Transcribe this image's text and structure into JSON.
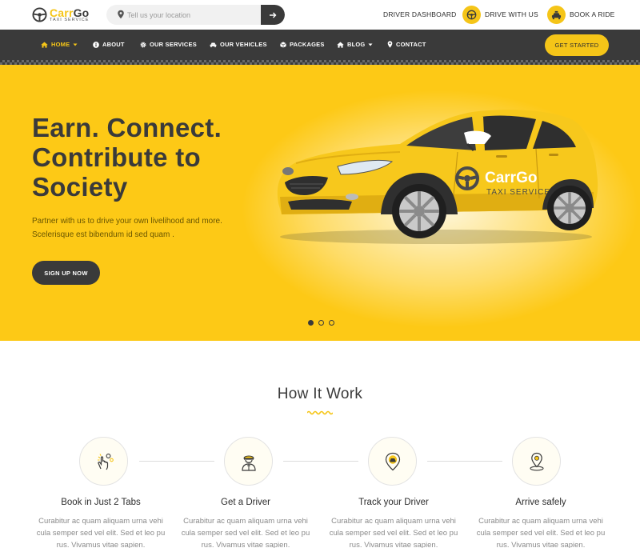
{
  "brand": {
    "name_part1": "Carr",
    "name_part2": "Go",
    "tagline": "TAXI SERVICE",
    "color_primary": "#f5c518",
    "color_dark": "#3a3a3a"
  },
  "search": {
    "placeholder": "Tell us your location",
    "icon": "map-pin-icon",
    "submit_icon": "arrow-right-icon"
  },
  "top_links": {
    "driver_dashboard": "DRIVER DASHBOARD",
    "drive_with_us": "DRIVE WITH US",
    "book_a_ride": "BOOK A RIDE"
  },
  "nav": {
    "items": [
      {
        "label": "HOME",
        "icon": "home-icon",
        "dropdown": true,
        "active": true
      },
      {
        "label": "ABOUT",
        "icon": "info-icon"
      },
      {
        "label": "OUR SERVICES",
        "icon": "gear-icon"
      },
      {
        "label": "OUR VEHICLES",
        "icon": "car-icon"
      },
      {
        "label": "PACKAGES",
        "icon": "box-icon"
      },
      {
        "label": "BLOG",
        "icon": "home-icon",
        "dropdown": true
      },
      {
        "label": "CONTACT",
        "icon": "map-pin-icon"
      }
    ],
    "cta": "GET STARTED"
  },
  "hero": {
    "title_lines": [
      "Earn. Connect.",
      "Contribute to",
      "Society"
    ],
    "text_lines": [
      "Partner with us to drive your own livelihood and more.",
      "Scelerisque est bibendum id sed quam ."
    ],
    "button": "SIGN UP NOW",
    "car_brand_1": "Carr",
    "car_brand_2": "Go",
    "car_tagline": "TAXI SERVICE",
    "slides_total": 3,
    "slide_active": 1
  },
  "how_it_works": {
    "title": "How It Work",
    "steps": [
      {
        "title": "Book in Just 2 Tabs",
        "icon": "tap-icon",
        "text_lines": [
          "Curabitur ac quam aliquam urna vehi",
          "cula semper sed vel elit. Sed et leo pu",
          "rus. Vivamus vitae sapien."
        ]
      },
      {
        "title": "Get a Driver",
        "icon": "driver-icon",
        "text_lines": [
          "Curabitur ac quam aliquam urna vehi",
          "cula semper sed vel elit. Sed et leo pu",
          "rus. Vivamus vitae sapien."
        ]
      },
      {
        "title": "Track your Driver",
        "icon": "track-icon",
        "text_lines": [
          "Curabitur ac quam aliquam urna vehi",
          "cula semper sed vel elit. Sed et leo pu",
          "rus. Vivamus vitae sapien."
        ]
      },
      {
        "title": "Arrive safely",
        "icon": "location-icon",
        "text_lines": [
          "Curabitur ac quam aliquam urna vehi",
          "cula semper sed vel elit. Sed et leo pu",
          "rus. Vivamus vitae sapien."
        ]
      }
    ]
  }
}
